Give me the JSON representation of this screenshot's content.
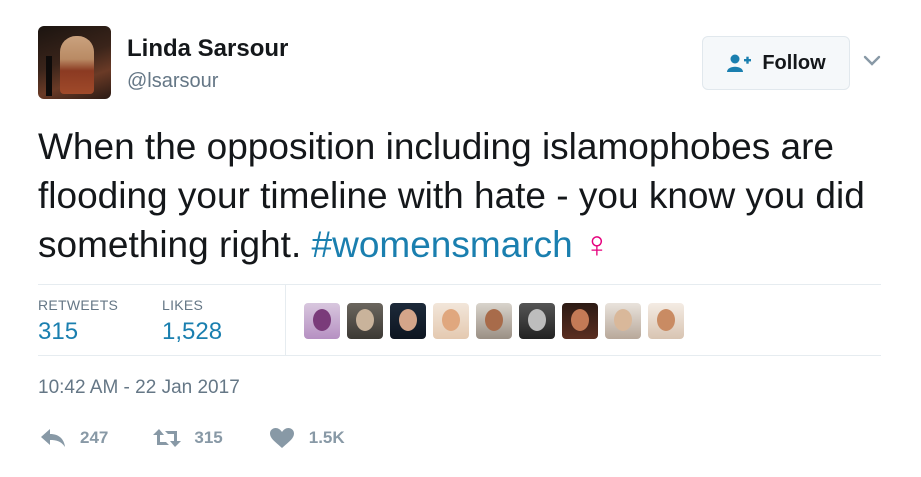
{
  "user": {
    "name": "Linda Sarsour",
    "handle": "@lsarsour"
  },
  "follow_button": {
    "label": "Follow"
  },
  "tweet": {
    "text": "When the opposition including islamophobes are flooding your timeline with hate - you know you did something right.",
    "hashtag": "#womensmarch",
    "emoji": "♀"
  },
  "stats": {
    "retweets_label": "RETWEETS",
    "retweets_value": "315",
    "likes_label": "LIKES",
    "likes_value": "1,528"
  },
  "likers_count": 9,
  "timestamp": "10:42 AM - 22 Jan 2017",
  "actions": {
    "reply_count": "247",
    "retweet_count": "315",
    "like_count": "1.5K"
  },
  "colors": {
    "link": "#1a7faf",
    "muted": "#657786",
    "icon": "#8899a6",
    "venus": "#e5007d"
  }
}
